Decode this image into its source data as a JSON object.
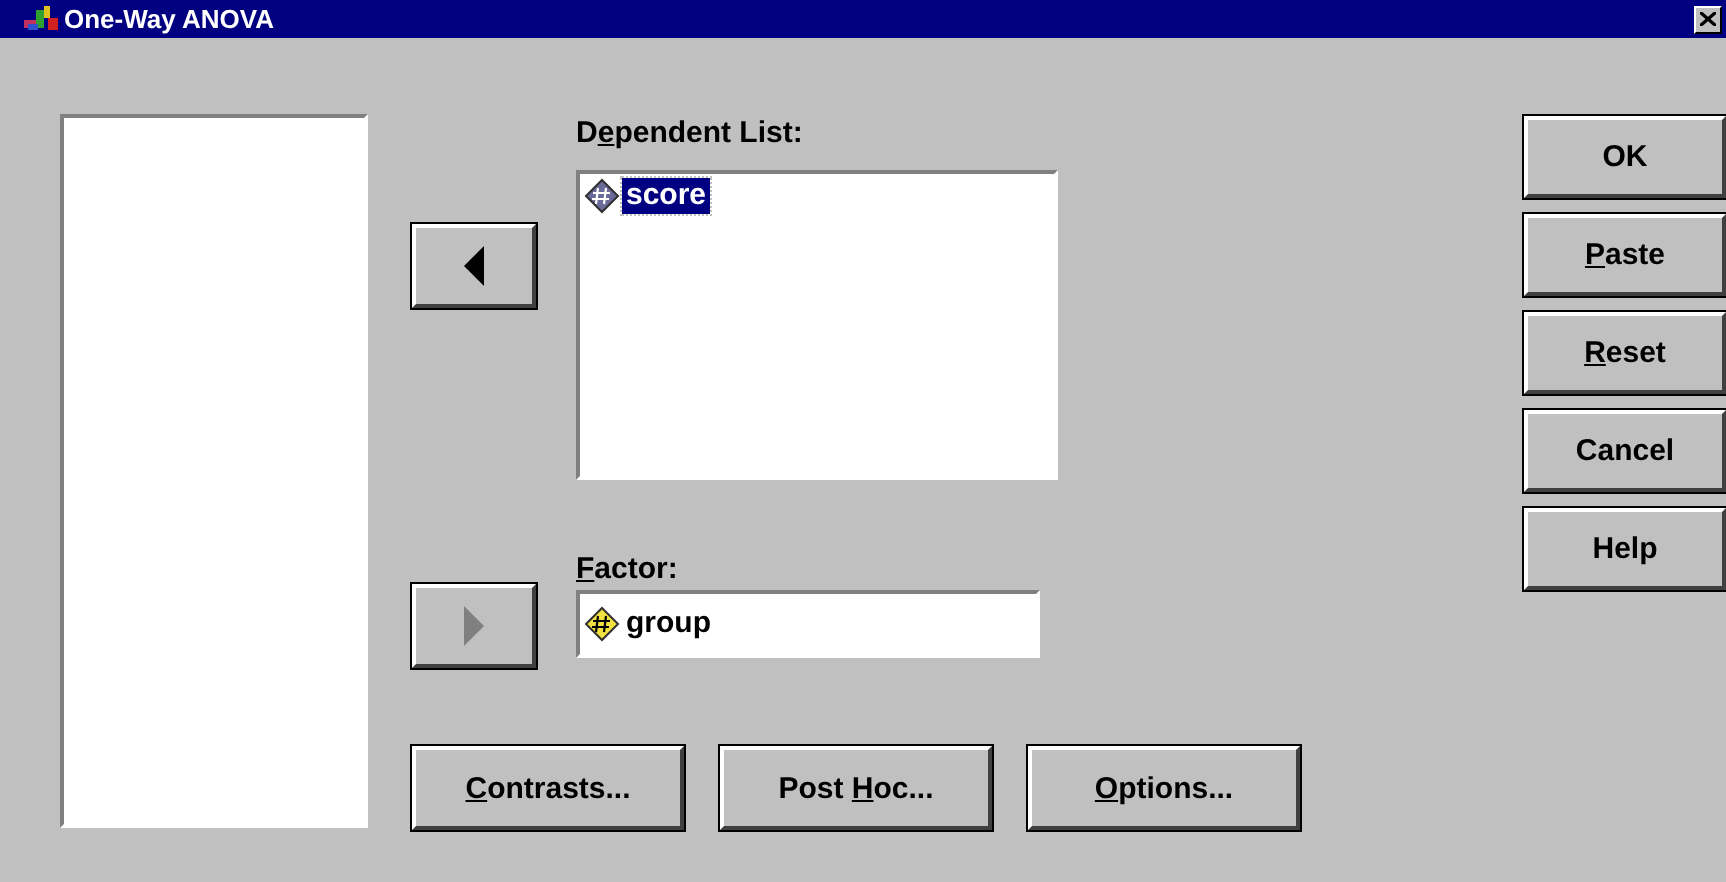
{
  "window": {
    "title": "One-Way ANOVA"
  },
  "dependent_list": {
    "label": {
      "before": "D",
      "key": "e",
      "after": "pendent List:"
    },
    "move_button": {
      "kind": "left",
      "disabled": false
    },
    "items": [
      {
        "name": "score",
        "kind": "scale",
        "selected": true
      }
    ]
  },
  "factor": {
    "label": {
      "key": "F",
      "after": "actor:"
    },
    "move_button": {
      "kind": "right",
      "disabled": true
    },
    "value": {
      "name": "group",
      "kind": "nominal"
    }
  },
  "side_buttons": [
    {
      "label": {
        "after": "OK"
      }
    },
    {
      "label": {
        "key": "P",
        "after": "aste"
      }
    },
    {
      "label": {
        "key": "R",
        "after": "eset"
      }
    },
    {
      "label": {
        "after": "Cancel"
      }
    },
    {
      "label": {
        "after": "Help"
      }
    }
  ],
  "bottom_buttons": [
    {
      "label": {
        "key": "C",
        "after": "ontrasts..."
      }
    },
    {
      "label": {
        "before": "Post ",
        "key": "H",
        "after": "oc..."
      }
    },
    {
      "label": {
        "key": "O",
        "after": "ptions..."
      }
    }
  ]
}
